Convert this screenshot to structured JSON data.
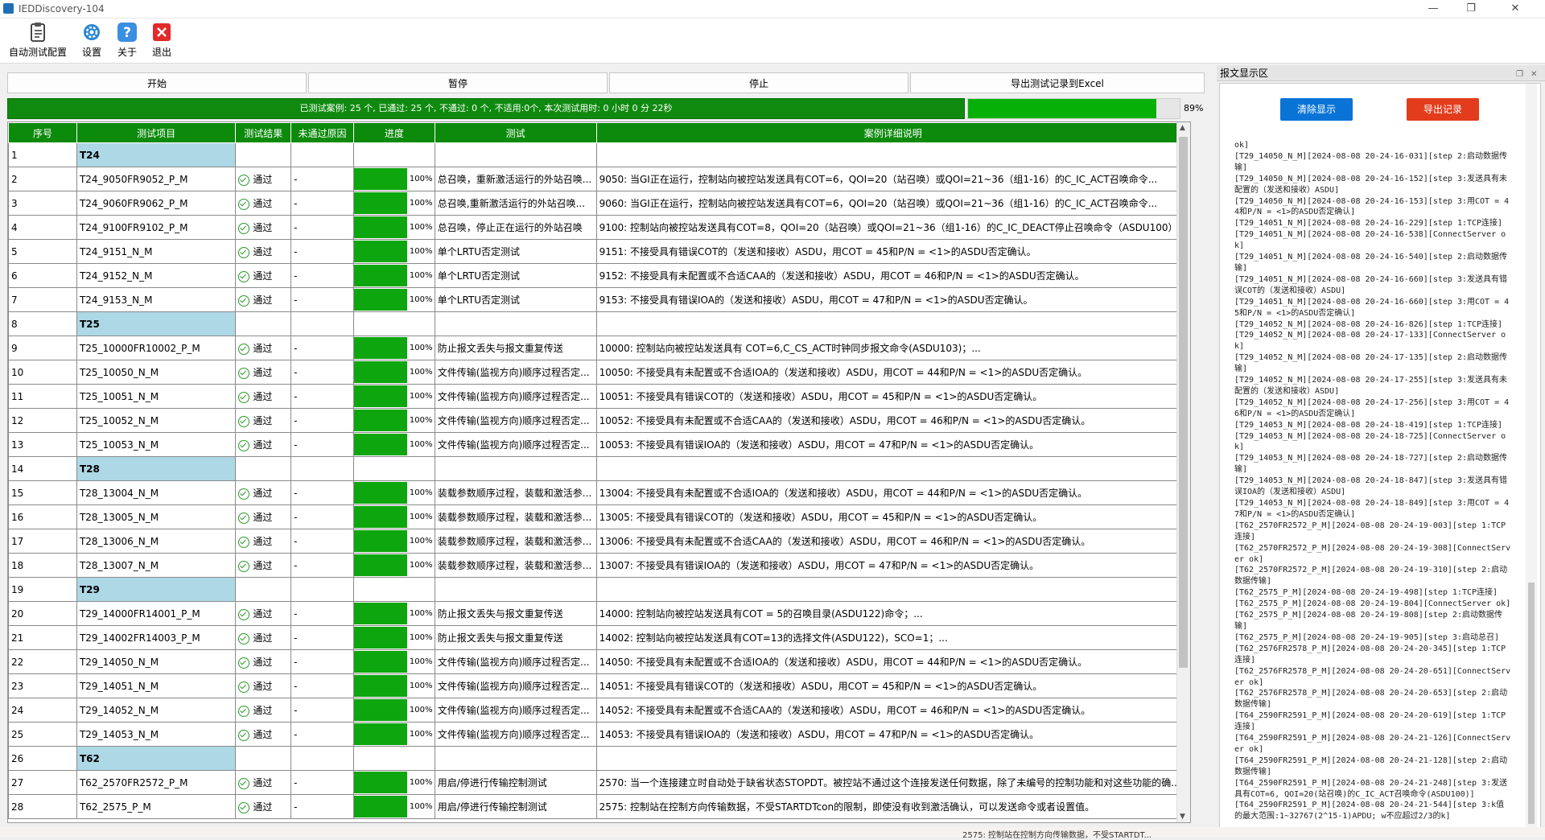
{
  "window": {
    "title": "IEDDiscovery-104",
    "minimize": "—",
    "restore": "❐",
    "close": "✕"
  },
  "toolbar": [
    {
      "label": "自动测试配置",
      "icon": "clipboard-config-icon"
    },
    {
      "label": "设置",
      "icon": "gear-icon"
    },
    {
      "label": "关于",
      "icon": "help-icon"
    },
    {
      "label": "退出",
      "icon": "exit-icon"
    }
  ],
  "actions": {
    "start": "开始",
    "pause": "暂停",
    "stop": "停止",
    "export": "导出测试记录到Excel"
  },
  "progress": {
    "summary": "已测试案例: 25 个, 已通过: 25 个, 不通过: 0 个, 不适用:0个, 本次测试用时: 0 小时 0 分 22秒",
    "percent_label": "89%",
    "percent": 0.89
  },
  "table": {
    "headers": [
      "序号",
      "测试项目",
      "测试结果",
      "未通过原因",
      "进度",
      "测试",
      "案例详细说明"
    ],
    "rows": [
      {
        "no": "1",
        "item": "T24",
        "group": true
      },
      {
        "no": "2",
        "item": "T24_9050FR9052_P_M",
        "result": "通过",
        "reason": "-",
        "progress": "100%",
        "test": "总召唤，重新激活运行的外站召唤...",
        "detail": "9050: 当GI正在运行，控制站向被控站发送具有COT=6，QOI=20（站召唤）或QOI=21~36（组1-16）的C_IC_ACT召唤命令..."
      },
      {
        "no": "3",
        "item": "T24_9060FR9062_P_M",
        "result": "通过",
        "reason": "-",
        "progress": "100%",
        "test": "总召唤,重新激活运行的外站召唤...",
        "detail": "9060: 当GI正在运行，控制站向被控站发送具有COT=6，QOI=20（站召唤）或QOI=21~36（组1-16）的C_IC_ACT召唤命令..."
      },
      {
        "no": "4",
        "item": "T24_9100FR9102_P_M",
        "result": "通过",
        "reason": "-",
        "progress": "100%",
        "test": "总召唤，停止正在运行的外站召唤",
        "detail": "9100: 控制站向被控站发送具有COT=8，QOI=20（站召唤）或QOI=21~36（组1-16）的C_IC_DEACT停止召唤命令（ASDU100）..."
      },
      {
        "no": "5",
        "item": "T24_9151_N_M",
        "result": "通过",
        "reason": "-",
        "progress": "100%",
        "test": "单个LRTU否定测试",
        "detail": "9151: 不接受具有错误COT的（发送和接收）ASDU，用COT = 45和P/N = <1>的ASDU否定确认。"
      },
      {
        "no": "6",
        "item": "T24_9152_N_M",
        "result": "通过",
        "reason": "-",
        "progress": "100%",
        "test": "单个LRTU否定测试",
        "detail": "9152: 不接受具有未配置或不合适CAA的（发送和接收）ASDU，用COT = 46和P/N = <1>的ASDU否定确认。"
      },
      {
        "no": "7",
        "item": "T24_9153_N_M",
        "result": "通过",
        "reason": "-",
        "progress": "100%",
        "test": "单个LRTU否定测试",
        "detail": "9153: 不接受具有错误IOA的（发送和接收）ASDU，用COT = 47和P/N = <1>的ASDU否定确认。"
      },
      {
        "no": "8",
        "item": "T25",
        "group": true
      },
      {
        "no": "9",
        "item": "T25_10000FR10002_P_M",
        "result": "通过",
        "reason": "-",
        "progress": "100%",
        "test": "防止报文丢失与报文重复传送",
        "detail": "10000: 控制站向被控站发送具有 COT=6,C_CS_ACT时钟同步报文命令(ASDU103)；..."
      },
      {
        "no": "10",
        "item": "T25_10050_N_M",
        "result": "通过",
        "reason": "-",
        "progress": "100%",
        "test": "文件传输(监视方向)顺序过程否定...",
        "detail": "10050: 不接受具有未配置或不合适IOA的（发送和接收）ASDU，用COT = 44和P/N = <1>的ASDU否定确认。"
      },
      {
        "no": "11",
        "item": "T25_10051_N_M",
        "result": "通过",
        "reason": "-",
        "progress": "100%",
        "test": "文件传输(监视方向)顺序过程否定...",
        "detail": "10051: 不接受具有错误COT的（发送和接收）ASDU，用COT = 45和P/N = <1>的ASDU否定确认。"
      },
      {
        "no": "12",
        "item": "T25_10052_N_M",
        "result": "通过",
        "reason": "-",
        "progress": "100%",
        "test": "文件传输(监视方向)顺序过程否定...",
        "detail": "10052: 不接受具有未配置或不合适CAA的（发送和接收）ASDU，用COT = 46和P/N = <1>的ASDU否定确认。"
      },
      {
        "no": "13",
        "item": "T25_10053_N_M",
        "result": "通过",
        "reason": "-",
        "progress": "100%",
        "test": "文件传输(监视方向)顺序过程否定...",
        "detail": "10053: 不接受具有错误IOA的（发送和接收）ASDU，用COT = 47和P/N = <1>的ASDU否定确认。"
      },
      {
        "no": "14",
        "item": "T28",
        "group": true
      },
      {
        "no": "15",
        "item": "T28_13004_N_M",
        "result": "通过",
        "reason": "-",
        "progress": "100%",
        "test": "装载参数顺序过程，装载和激活参...",
        "detail": "13004: 不接受具有未配置或不合适IOA的（发送和接收）ASDU，用COT = 44和P/N = <1>的ASDU否定确认。"
      },
      {
        "no": "16",
        "item": "T28_13005_N_M",
        "result": "通过",
        "reason": "-",
        "progress": "100%",
        "test": "装载参数顺序过程，装载和激活参...",
        "detail": "13005: 不接受具有错误COT的（发送和接收）ASDU，用COT = 45和P/N = <1>的ASDU否定确认。"
      },
      {
        "no": "17",
        "item": "T28_13006_N_M",
        "result": "通过",
        "reason": "-",
        "progress": "100%",
        "test": "装载参数顺序过程，装载和激活参...",
        "detail": "13006: 不接受具有未配置或不合适CAA的（发送和接收）ASDU，用COT = 46和P/N = <1>的ASDU否定确认。"
      },
      {
        "no": "18",
        "item": "T28_13007_N_M",
        "result": "通过",
        "reason": "-",
        "progress": "100%",
        "test": "装载参数顺序过程，装载和激活参...",
        "detail": "13007: 不接受具有错误IOA的（发送和接收）ASDU，用COT = 47和P/N = <1>的ASDU否定确认。"
      },
      {
        "no": "19",
        "item": "T29",
        "group": true
      },
      {
        "no": "20",
        "item": "T29_14000FR14001_P_M",
        "result": "通过",
        "reason": "-",
        "progress": "100%",
        "test": "防止报文丢失与报文重复传送",
        "detail": "14000: 控制站向被控站发送具有COT = 5的召唤目录(ASDU122)命令；..."
      },
      {
        "no": "21",
        "item": "T29_14002FR14003_P_M",
        "result": "通过",
        "reason": "-",
        "progress": "100%",
        "test": "防止报文丢失与报文重复传送",
        "detail": "14002: 控制站向被控站发送具有COT=13的选择文件(ASDU122)，SCO=1；..."
      },
      {
        "no": "22",
        "item": "T29_14050_N_M",
        "result": "通过",
        "reason": "-",
        "progress": "100%",
        "test": "文件传输(监视方向)顺序过程否定...",
        "detail": "14050: 不接受具有未配置或不合适IOA的（发送和接收）ASDU，用COT = 44和P/N = <1>的ASDU否定确认。"
      },
      {
        "no": "23",
        "item": "T29_14051_N_M",
        "result": "通过",
        "reason": "-",
        "progress": "100%",
        "test": "文件传输(监视方向)顺序过程否定...",
        "detail": "14051: 不接受具有错误COT的（发送和接收）ASDU，用COT = 45和P/N = <1>的ASDU否定确认。"
      },
      {
        "no": "24",
        "item": "T29_14052_N_M",
        "result": "通过",
        "reason": "-",
        "progress": "100%",
        "test": "文件传输(监视方向)顺序过程否定...",
        "detail": "14052: 不接受具有未配置或不合适CAA的（发送和接收）ASDU，用COT = 46和P/N = <1>的ASDU否定确认。"
      },
      {
        "no": "25",
        "item": "T29_14053_N_M",
        "result": "通过",
        "reason": "-",
        "progress": "100%",
        "test": "文件传输(监视方向)顺序过程否定...",
        "detail": "14053: 不接受具有错误IOA的（发送和接收）ASDU，用COT = 47和P/N = <1>的ASDU否定确认。"
      },
      {
        "no": "26",
        "item": "T62",
        "group": true
      },
      {
        "no": "27",
        "item": "T62_2570FR2572_P_M",
        "result": "通过",
        "reason": "-",
        "progress": "100%",
        "test": "用启/停进行传输控制测试",
        "detail": "2570: 当一个连接建立时自动处于缺省状态STOPDT。被控站不通过这个连接发送任何数据，除了未编号的控制功能和对这些功能的确..."
      },
      {
        "no": "28",
        "item": "T62_2575_P_M",
        "result": "通过",
        "reason": "-",
        "progress": "100%",
        "test": "用启/停进行传输控制测试",
        "detail": "2575: 控制站在控制方向传输数据，不受STARTDTcon的限制，即使没有收到激活确认，可以发送命令或者设置值。"
      }
    ]
  },
  "log_panel": {
    "title": "报文显示区",
    "clear_label": "清除显示",
    "export_label": "导出记录",
    "lines": [
      "ok]",
      "[T29_14050_N_M][2024-08-08 20-24-16-031][step 2:启动数据传输]",
      "[T29_14050_N_M][2024-08-08 20-24-16-152][step 3:发送具有未配置的（发送和接收）ASDU]",
      "[T29_14050_N_M][2024-08-08 20-24-16-153][step 3:用COT = 44和P/N = <1>的ASDU否定确认]",
      "[T29_14051_N_M][2024-08-08 20-24-16-229][step 1:TCP连接]",
      "[T29_14051_N_M][2024-08-08 20-24-16-538][ConnectServer ok]",
      "[T29_14051_N_M][2024-08-08 20-24-16-540][step 2:启动数据传输]",
      "[T29_14051_N_M][2024-08-08 20-24-16-660][step 3:发送具有错误COT的（发送和接收）ASDU]",
      "[T29_14051_N_M][2024-08-08 20-24-16-660][step 3:用COT = 45和P/N = <1>的ASDU否定确认]",
      "[T29_14052_N_M][2024-08-08 20-24-16-826][step 1:TCP连接]",
      "[T29_14052_N_M][2024-08-08 20-24-17-133][ConnectServer ok]",
      "[T29_14052_N_M][2024-08-08 20-24-17-135][step 2:启动数据传输]",
      "[T29_14052_N_M][2024-08-08 20-24-17-255][step 3:发送具有未配置的（发送和接收）ASDU]",
      "[T29_14052_N_M][2024-08-08 20-24-17-256][step 3:用COT = 46和P/N = <1>的ASDU否定确认]",
      "[T29_14053_N_M][2024-08-08 20-24-18-419][step 1:TCP连接]",
      "[T29_14053_N_M][2024-08-08 20-24-18-725][ConnectServer ok]",
      "[T29_14053_N_M][2024-08-08 20-24-18-727][step 2:启动数据传输]",
      "[T29_14053_N_M][2024-08-08 20-24-18-847][step 3:发送具有错误IOA的（发送和接收）ASDU]",
      "[T29_14053_N_M][2024-08-08 20-24-18-849][step 3:用COT = 47和P/N = <1>的ASDU否定确认]",
      "[T62_2570FR2572_P_M][2024-08-08 20-24-19-003][step 1:TCP连接]",
      "[T62_2570FR2572_P_M][2024-08-08 20-24-19-308][ConnectServer ok]",
      "[T62_2570FR2572_P_M][2024-08-08 20-24-19-310][step 2:启动数据传输]",
      "[T62_2575_P_M][2024-08-08 20-24-19-498][step 1:TCP连接]",
      "[T62_2575_P_M][2024-08-08 20-24-19-804][ConnectServer ok]",
      "[T62_2575_P_M][2024-08-08 20-24-19-808][step 2:启动数据传输]",
      "[T62_2575_P_M][2024-08-08 20-24-19-905][step 3:启动总召]",
      "[T62_2576FR2578_P_M][2024-08-08 20-24-20-345][step 1:TCP连接]",
      "[T62_2576FR2578_P_M][2024-08-08 20-24-20-651][ConnectServer ok]",
      "[T62_2576FR2578_P_M][2024-08-08 20-24-20-653][step 2:启动数据传输]",
      "[T64_2590FR2591_P_M][2024-08-08 20-24-20-619][step 1:TCP连接]",
      "[T64_2590FR2591_P_M][2024-08-08 20-24-21-126][ConnectServer ok]",
      "[T64_2590FR2591_P_M][2024-08-08 20-24-21-128][step 2:启动数据传输]",
      "[T64_2590FR2591_P_M][2024-08-08 20-24-21-248][step 3:发送具有COT=6, QOI=20(站召唤)的C_IC_ACT召唤命令(ASDU100)]",
      "[T64_2590FR2591_P_M][2024-08-08 20-24-21-544][step 3:k值的最大范围:1~32767(2^15-1)APDU; w不应超过2/3的k]"
    ]
  },
  "status": {
    "fragment": "2575: 控制站在控制方向传输数据，不受STARTDT..."
  },
  "colors": {
    "header_green": "#0c8a0c",
    "progress_green": "#0ea60e",
    "group_blue": "#add8e6",
    "clear_btn": "#0a74d6",
    "export_btn": "#e23c1c"
  }
}
